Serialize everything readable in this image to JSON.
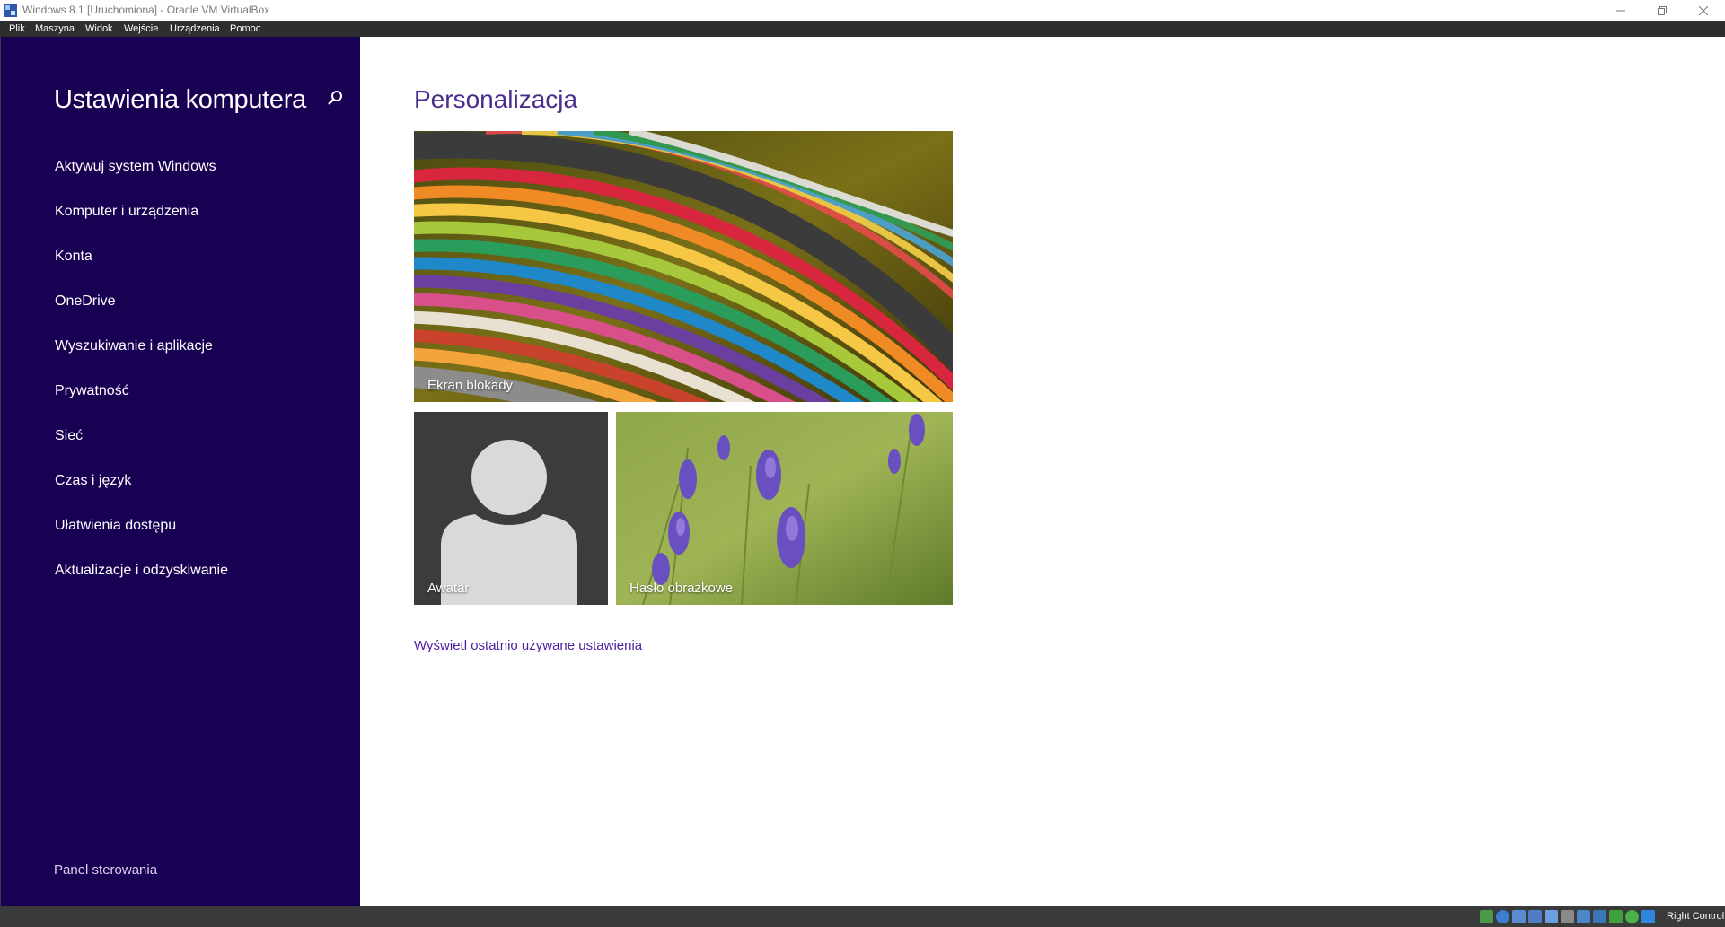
{
  "window": {
    "title": "Windows 8.1 [Uruchomiona] - Oracle VM VirtualBox"
  },
  "menubar": [
    "Plik",
    "Maszyna",
    "Widok",
    "Wejście",
    "Urządzenia",
    "Pomoc"
  ],
  "sidebar": {
    "title": "Ustawienia komputera",
    "items": [
      {
        "label": "Aktywuj system Windows"
      },
      {
        "label": "Komputer i urządzenia"
      },
      {
        "label": "Konta"
      },
      {
        "label": "OneDrive"
      },
      {
        "label": "Wyszukiwanie i aplikacje"
      },
      {
        "label": "Prywatność"
      },
      {
        "label": "Sieć"
      },
      {
        "label": "Czas i język"
      },
      {
        "label": "Ułatwienia dostępu"
      },
      {
        "label": "Aktualizacje i odzyskiwanie"
      }
    ],
    "footer": "Panel sterowania"
  },
  "main": {
    "title": "Personalizacja",
    "tiles": {
      "lock": "Ekran blokady",
      "avatar": "Awatar",
      "picture_password": "Hasło obrazkowe"
    },
    "recent_link": "Wyświetl ostatnio używane ustawienia"
  },
  "statusbar": {
    "host_key": "Right Control",
    "icons": [
      "hdd-icon",
      "optical-icon",
      "audio-icon",
      "network-icon",
      "usb-icon",
      "shared-folder-icon",
      "display-icon",
      "recording-icon",
      "mouse-integration-icon",
      "cpu-icon",
      "arrow-down-icon"
    ]
  },
  "colors": {
    "sidebar_bg": "#180052",
    "accent_title": "#4b2b8c",
    "link": "#4b1fa0",
    "menubar_bg": "#2e2e2e",
    "statusbar_bg": "#3a3a3a"
  }
}
